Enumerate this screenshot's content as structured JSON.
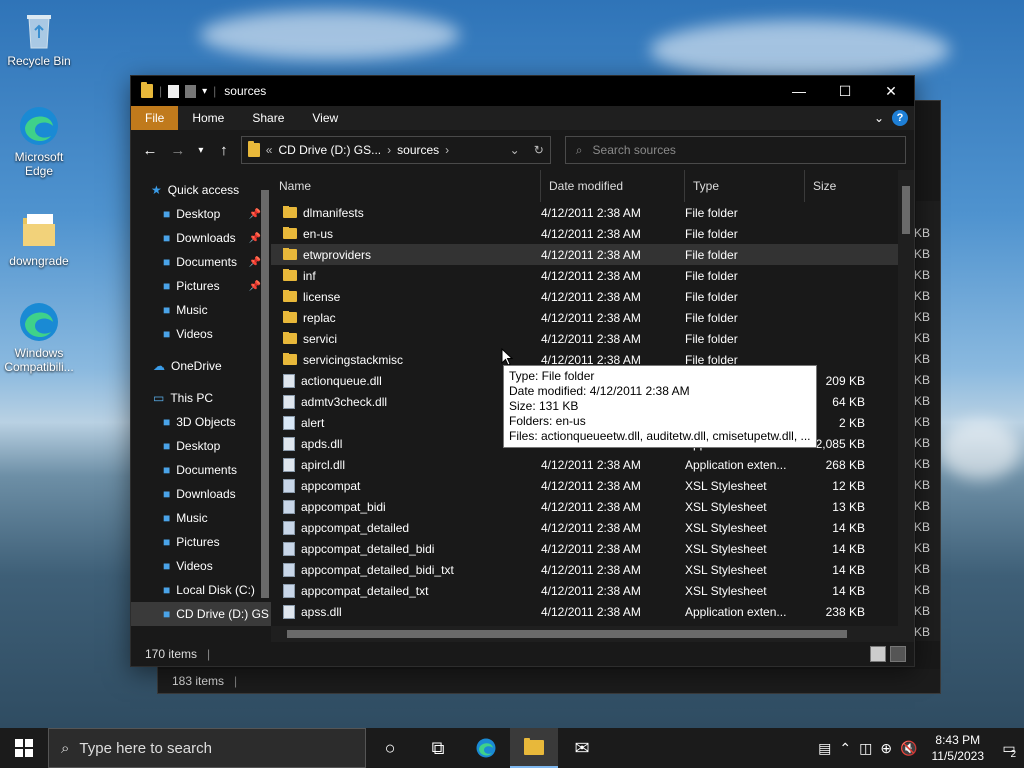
{
  "desktop": {
    "icons": [
      {
        "label": "Recycle Bin"
      },
      {
        "label": "Microsoft Edge"
      },
      {
        "label": "downgrade"
      },
      {
        "label": "Windows Compatibili..."
      }
    ]
  },
  "back_window": {
    "status_items": "183 items",
    "size_suffix": [
      "KB",
      "KB",
      "KB",
      "KB",
      "KB",
      "KB",
      "KB",
      "KB",
      "KB",
      "KB",
      "KB",
      "KB",
      "KB",
      "KB",
      "KB",
      "KB",
      "KB",
      "KB",
      "KB",
      "KB"
    ]
  },
  "window": {
    "title": "sources",
    "controls": {
      "minimize": "—",
      "maximize": "☐",
      "close": "✕"
    },
    "ribbon_tabs": [
      "File",
      "Home",
      "Share",
      "View"
    ],
    "address": {
      "drive": "CD Drive (D:) GS...",
      "folder": "sources",
      "prefix": "«",
      "sep1": "›",
      "sep2": "›"
    },
    "search_placeholder": "Search sources",
    "nav": {
      "quick_access": "Quick access",
      "qa_items": [
        {
          "label": "Desktop",
          "pinned": true
        },
        {
          "label": "Downloads",
          "pinned": true
        },
        {
          "label": "Documents",
          "pinned": true
        },
        {
          "label": "Pictures",
          "pinned": true
        },
        {
          "label": "Music",
          "pinned": false
        },
        {
          "label": "Videos",
          "pinned": false
        }
      ],
      "onedrive": "OneDrive",
      "this_pc": "This PC",
      "pc_items": [
        "3D Objects",
        "Desktop",
        "Documents",
        "Downloads",
        "Music",
        "Pictures",
        "Videos",
        "Local Disk (C:)",
        "CD Drive (D:) GS"
      ]
    },
    "columns": {
      "name": "Name",
      "date": "Date modified",
      "type": "Type",
      "size": "Size"
    },
    "files": [
      {
        "name": "dlmanifests",
        "date": "4/12/2011 2:38 AM",
        "type": "File folder",
        "size": "",
        "kind": "folder"
      },
      {
        "name": "en-us",
        "date": "4/12/2011 2:38 AM",
        "type": "File folder",
        "size": "",
        "kind": "folder"
      },
      {
        "name": "etwproviders",
        "date": "4/12/2011 2:38 AM",
        "type": "File folder",
        "size": "",
        "kind": "folder"
      },
      {
        "name": "inf",
        "date": "4/12/2011 2:38 AM",
        "type": "File folder",
        "size": "",
        "kind": "folder"
      },
      {
        "name": "license",
        "date": "4/12/2011 2:38 AM",
        "type": "File folder",
        "size": "",
        "kind": "folder"
      },
      {
        "name": "replac",
        "date": "4/12/2011 2:38 AM",
        "type": "File folder",
        "size": "",
        "kind": "folder"
      },
      {
        "name": "servici",
        "date": "4/12/2011 2:38 AM",
        "type": "File folder",
        "size": "",
        "kind": "folder"
      },
      {
        "name": "servicingstackmisc",
        "date": "4/12/2011 2:38 AM",
        "type": "File folder",
        "size": "",
        "kind": "folder"
      },
      {
        "name": "actionqueue.dll",
        "date": "4/12/2011 2:38 AM",
        "type": "Application exten...",
        "size": "209 KB",
        "kind": "dll"
      },
      {
        "name": "admtv3check.dll",
        "date": "4/12/2011 2:38 AM",
        "type": "Application exten...",
        "size": "64 KB",
        "kind": "dll"
      },
      {
        "name": "alert",
        "date": "4/12/2011 2:38 AM",
        "type": "GIF File",
        "size": "2 KB",
        "kind": "gif"
      },
      {
        "name": "apds.dll",
        "date": "4/12/2011 2:38 AM",
        "type": "Application exten...",
        "size": "2,085 KB",
        "kind": "dll"
      },
      {
        "name": "apircl.dll",
        "date": "4/12/2011 2:38 AM",
        "type": "Application exten...",
        "size": "268 KB",
        "kind": "dll"
      },
      {
        "name": "appcompat",
        "date": "4/12/2011 2:38 AM",
        "type": "XSL Stylesheet",
        "size": "12 KB",
        "kind": "xsl"
      },
      {
        "name": "appcompat_bidi",
        "date": "4/12/2011 2:38 AM",
        "type": "XSL Stylesheet",
        "size": "13 KB",
        "kind": "xsl"
      },
      {
        "name": "appcompat_detailed",
        "date": "4/12/2011 2:38 AM",
        "type": "XSL Stylesheet",
        "size": "14 KB",
        "kind": "xsl"
      },
      {
        "name": "appcompat_detailed_bidi",
        "date": "4/12/2011 2:38 AM",
        "type": "XSL Stylesheet",
        "size": "14 KB",
        "kind": "xsl"
      },
      {
        "name": "appcompat_detailed_bidi_txt",
        "date": "4/12/2011 2:38 AM",
        "type": "XSL Stylesheet",
        "size": "14 KB",
        "kind": "xsl"
      },
      {
        "name": "appcompat_detailed_txt",
        "date": "4/12/2011 2:38 AM",
        "type": "XSL Stylesheet",
        "size": "14 KB",
        "kind": "xsl"
      },
      {
        "name": "apss.dll",
        "date": "4/12/2011 2:38 AM",
        "type": "Application exten...",
        "size": "238 KB",
        "kind": "dll"
      }
    ],
    "hovered_row": 2,
    "tooltip": {
      "type": "Type: File folder",
      "date": "Date modified: 4/12/2011 2:38 AM",
      "size": "Size: 131 KB",
      "folders": "Folders: en-us",
      "files": "Files: actionqueueetw.dll, auditetw.dll, cmisetupetw.dll, ..."
    },
    "status_items": "170 items"
  },
  "taskbar": {
    "search_placeholder": "Type here to search",
    "time": "8:43 PM",
    "date": "11/5/2023",
    "notification_count": "2"
  },
  "colors": {
    "file_tab": "#c07a1c",
    "folder": "#e8b83a",
    "accent": "#1e7fd6"
  }
}
